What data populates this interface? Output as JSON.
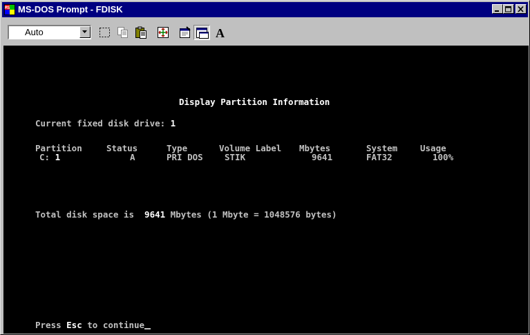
{
  "window": {
    "title": "MS-DOS Prompt - FDISK",
    "icon": "ms-dos-icon"
  },
  "toolbar": {
    "font_size_value": "Auto",
    "tools": [
      "mark-icon",
      "copy-icon",
      "paste-icon",
      "fullscreen-icon",
      "properties-icon",
      "background-icon",
      "font-icon"
    ],
    "font_tool_label": "A"
  },
  "console": {
    "heading": "Display Partition Information",
    "current_drive_label": "Current fixed disk drive: ",
    "current_drive_value": "1",
    "table": {
      "headers": [
        "Partition",
        "Status",
        "Type",
        "Volume Label",
        "Mbytes",
        "System",
        "Usage"
      ],
      "rows": [
        {
          "drive": "C:",
          "partition": "1",
          "status": "A",
          "type": "PRI DOS",
          "volume_label": "STIK",
          "mbytes": "9641",
          "system": "FAT32",
          "usage": "100%"
        }
      ]
    },
    "total_prefix": "Total disk space is ",
    "total_value": "9641",
    "total_suffix": " Mbytes (1 Mbyte = 1048576 bytes)",
    "prompt_prefix": "Press ",
    "prompt_key": "Esc",
    "prompt_suffix": " to continue"
  }
}
